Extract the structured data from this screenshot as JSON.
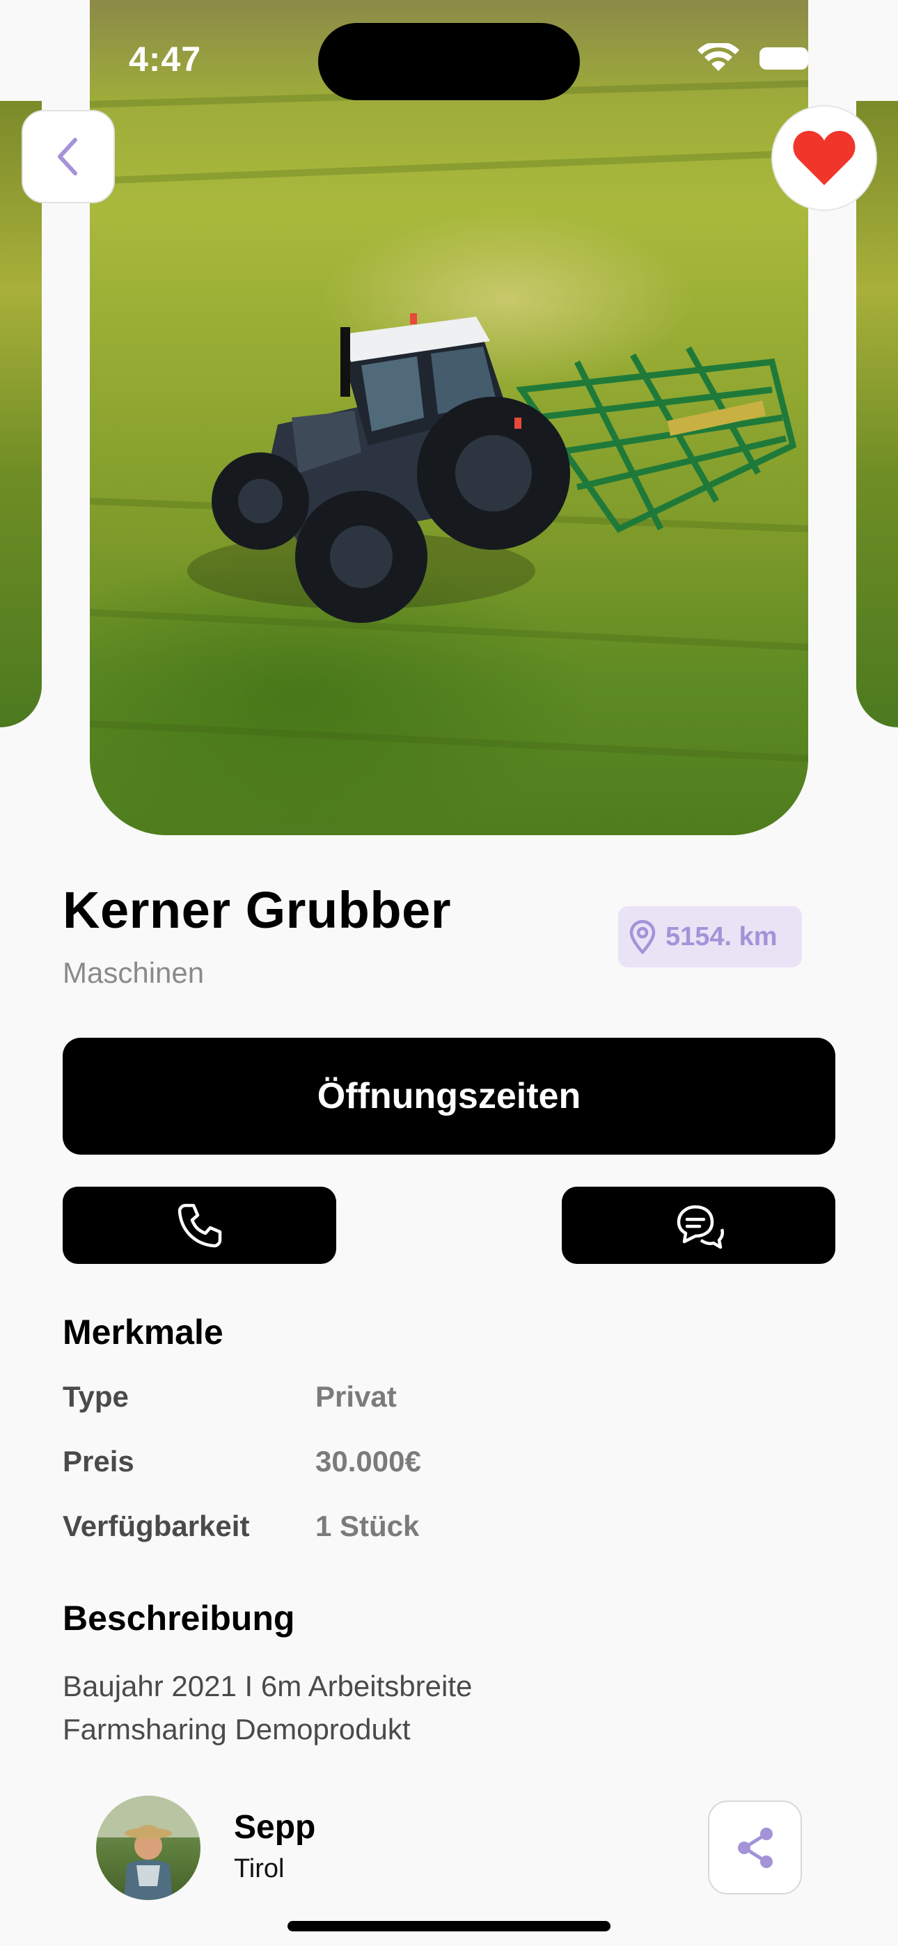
{
  "status_bar": {
    "time": "4:47"
  },
  "product": {
    "title": "Kerner Grubber",
    "category": "Maschinen",
    "distance": "5154. km"
  },
  "actions": {
    "opening_hours_label": "Öffnungszeiten",
    "call_icon": "phone-icon",
    "chat_icon": "chat-bubbles-icon"
  },
  "features": {
    "heading": "Merkmale",
    "rows": [
      {
        "label": "Type",
        "value": "Privat"
      },
      {
        "label": "Preis",
        "value": "30.000€"
      },
      {
        "label": "Verfügbarkeit",
        "value": "1 Stück"
      }
    ]
  },
  "description": {
    "heading": "Beschreibung",
    "lines": [
      "Baujahr 2021 I 6m Arbeitsbreite",
      "Farmsharing Demoprodukt"
    ]
  },
  "seller": {
    "name": "Sepp",
    "region": "Tirol"
  },
  "colors": {
    "accent_purple": "#a493d8",
    "badge_bg": "#e9e3f6",
    "favorite_red": "#f0352b",
    "button_black": "#000000"
  }
}
